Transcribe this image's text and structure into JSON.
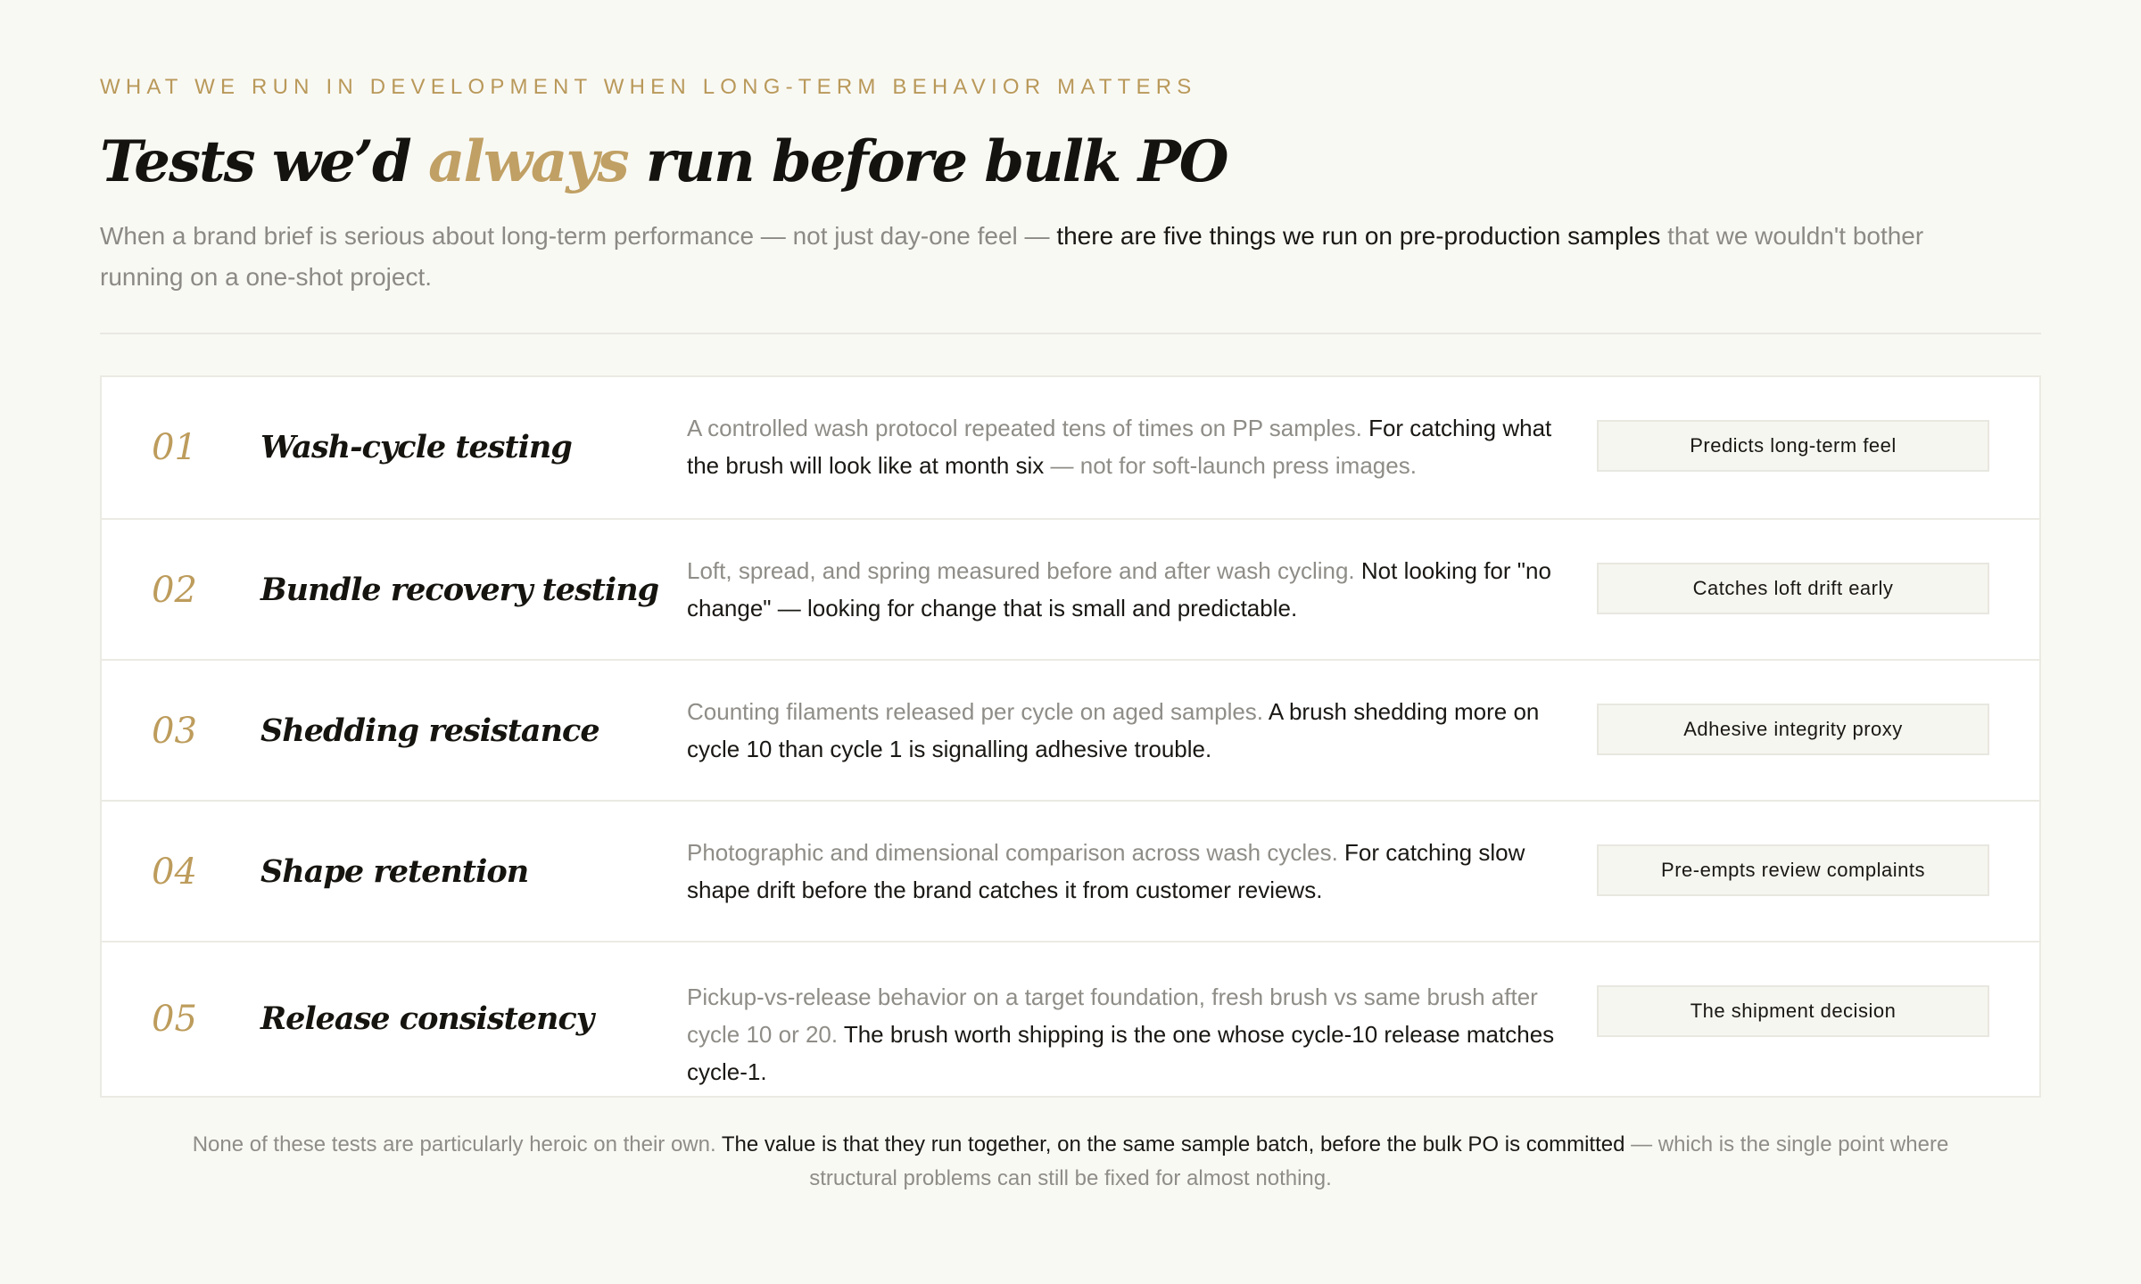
{
  "header": {
    "eyebrow": "WHAT WE RUN IN DEVELOPMENT WHEN LONG-TERM BEHAVIOR MATTERS",
    "title_before": "Tests we’d ",
    "title_accent": "always",
    "title_after": " run before bulk PO",
    "lede_muted_1": "When a brand brief is serious about long-term performance — not just day-one feel — ",
    "lede_strong": "there are five things we run on pre-production samples",
    "lede_muted_2": " that we wouldn't bother running on a one-shot project."
  },
  "tests": [
    {
      "number": "01",
      "name": "Wash-cycle testing",
      "desc_muted": "A controlled wash protocol repeated tens of times on PP samples. ",
      "desc_strong": "For catching what the brush will look like at month six",
      "desc_tail": " — not for soft-launch press images.",
      "tag": "Predicts long-term feel"
    },
    {
      "number": "02",
      "name": "Bundle recovery testing",
      "desc_muted": "Loft, spread, and spring measured before and after wash cycling. ",
      "desc_strong": "Not looking for \"no change\" — looking for change that is small and predictable.",
      "desc_tail": "",
      "tag": "Catches loft drift early"
    },
    {
      "number": "03",
      "name": "Shedding resistance",
      "desc_muted": "Counting filaments released per cycle on aged samples. ",
      "desc_strong": "A brush shedding more on cycle 10 than cycle 1 is signalling adhesive trouble.",
      "desc_tail": "",
      "tag": "Adhesive integrity proxy"
    },
    {
      "number": "04",
      "name": "Shape retention",
      "desc_muted": "Photographic and dimensional comparison across wash cycles. ",
      "desc_strong": "For catching slow shape drift before the brand catches it from customer reviews.",
      "desc_tail": "",
      "tag": "Pre-empts review complaints"
    },
    {
      "number": "05",
      "name": "Release consistency",
      "desc_muted": "Pickup-vs-release behavior on a target foundation, fresh brush vs same brush after cycle 10 or 20. ",
      "desc_strong": "The brush worth shipping is the one whose cycle-10 release matches cycle-1.",
      "desc_tail": "",
      "tag": "The shipment decision"
    }
  ],
  "footnote": {
    "muted_1": "None of these tests are particularly heroic on their own. ",
    "strong": "The value is that they run together, on the same sample batch, before the bulk PO is committed",
    "muted_2": " — which is the single point where structural problems can still be fixed for almost nothing."
  },
  "colors": {
    "background": "#f9f9f4",
    "accent_gold": "#bd9c5c",
    "text_dark": "#1a1814",
    "text_muted": "#8f8d87"
  }
}
